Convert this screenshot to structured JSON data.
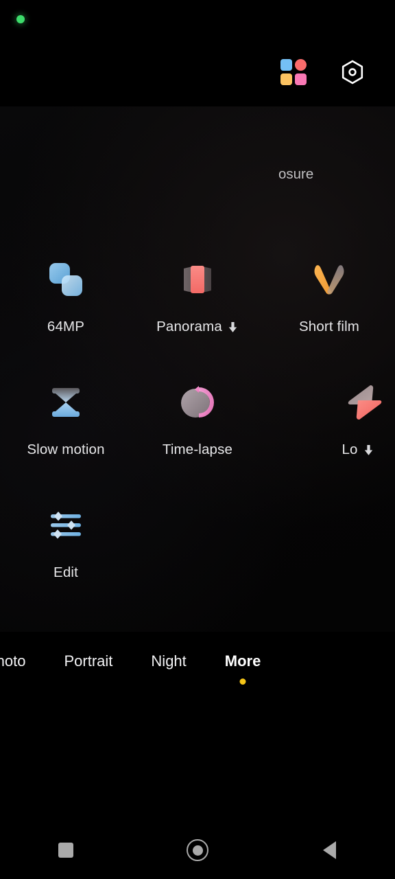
{
  "status": {
    "privacy_indicator": "camera-in-use"
  },
  "top_bar": {
    "filters_icon": "color-filters-icon",
    "settings_icon": "hexagon-aperture-settings-icon"
  },
  "more_panel": {
    "modes": [
      {
        "label": "64MP",
        "icon": "overlapping-squares-icon",
        "has_download": false
      },
      {
        "label": "Panorama",
        "icon": "panorama-barrel-icon",
        "has_download": true
      },
      {
        "label": "Short film",
        "icon": "v-shape-film-icon",
        "has_download": false
      },
      {
        "label": "Slow motion",
        "icon": "hourglass-icon",
        "has_download": false
      },
      {
        "label": "Time-lapse",
        "icon": "clock-circle-icon",
        "has_download": false
      },
      {
        "label": "Lo",
        "icon": "lightning-bolt-icon",
        "has_download": true
      },
      {
        "label": "Edit",
        "icon": "sliders-icon",
        "has_download": false
      }
    ],
    "ghost_label": "osure"
  },
  "mode_bar": {
    "tabs": [
      {
        "label": "Photo",
        "active": false
      },
      {
        "label": "Portrait",
        "active": false
      },
      {
        "label": "Night",
        "active": false
      },
      {
        "label": "More",
        "active": true
      }
    ],
    "active_dot_color": "#f5c518"
  },
  "nav_bar": {
    "recents": "recents-square-icon",
    "home": "home-circle-icon",
    "back": "back-triangle-icon"
  },
  "colors": {
    "background": "#000000",
    "accent_yellow": "#f5c518",
    "privacy_green": "#3ddc6b",
    "label_text": "#e8e8ea"
  }
}
